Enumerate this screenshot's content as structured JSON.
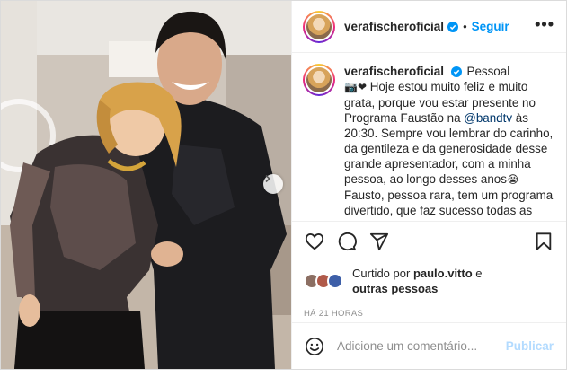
{
  "post": {
    "username": "verafischeroficial",
    "follow_label": "Seguir",
    "more_label": "•••",
    "dot_separator": "•"
  },
  "caption": {
    "username": "verafischeroficial",
    "tag": "Pessoal",
    "emojis": "📷❤",
    "text_before_mention": "Hoje estou muito feliz e muito grata, porque vou estar presente no Programa Faustão na",
    "mention": "@bandtv",
    "text_after_mention": "às 20:30. Sempre vou lembrar do carinho, da gentileza e da generosidade desse grande apresentador, com a minha pessoa, ao longo desses anos",
    "emoji_after": "😭",
    "text_end": "Fausto, pessoa rara, tem um programa divertido, que faz sucesso todas as noites. Desejo que Deus te ilumine sempre."
  },
  "likes": {
    "prefix": "Curtido por",
    "user": "paulo.vitto",
    "suffix": "e",
    "others": "outras pessoas"
  },
  "timestamp": "HÁ 21 HORAS",
  "comment": {
    "placeholder": "Adicione um comentário...",
    "publish_label": "Publicar"
  },
  "icons": {
    "like": "heart-icon",
    "comment": "comment-icon",
    "share": "send-icon",
    "save": "bookmark-icon",
    "emoji": "smiley-icon",
    "verified": "verified-badge-icon",
    "next": "chevron-right-icon"
  },
  "colors": {
    "accent": "#0095f6",
    "publish_disabled": "#b3dbff",
    "muted": "#8e8e8e",
    "text": "#262626"
  }
}
